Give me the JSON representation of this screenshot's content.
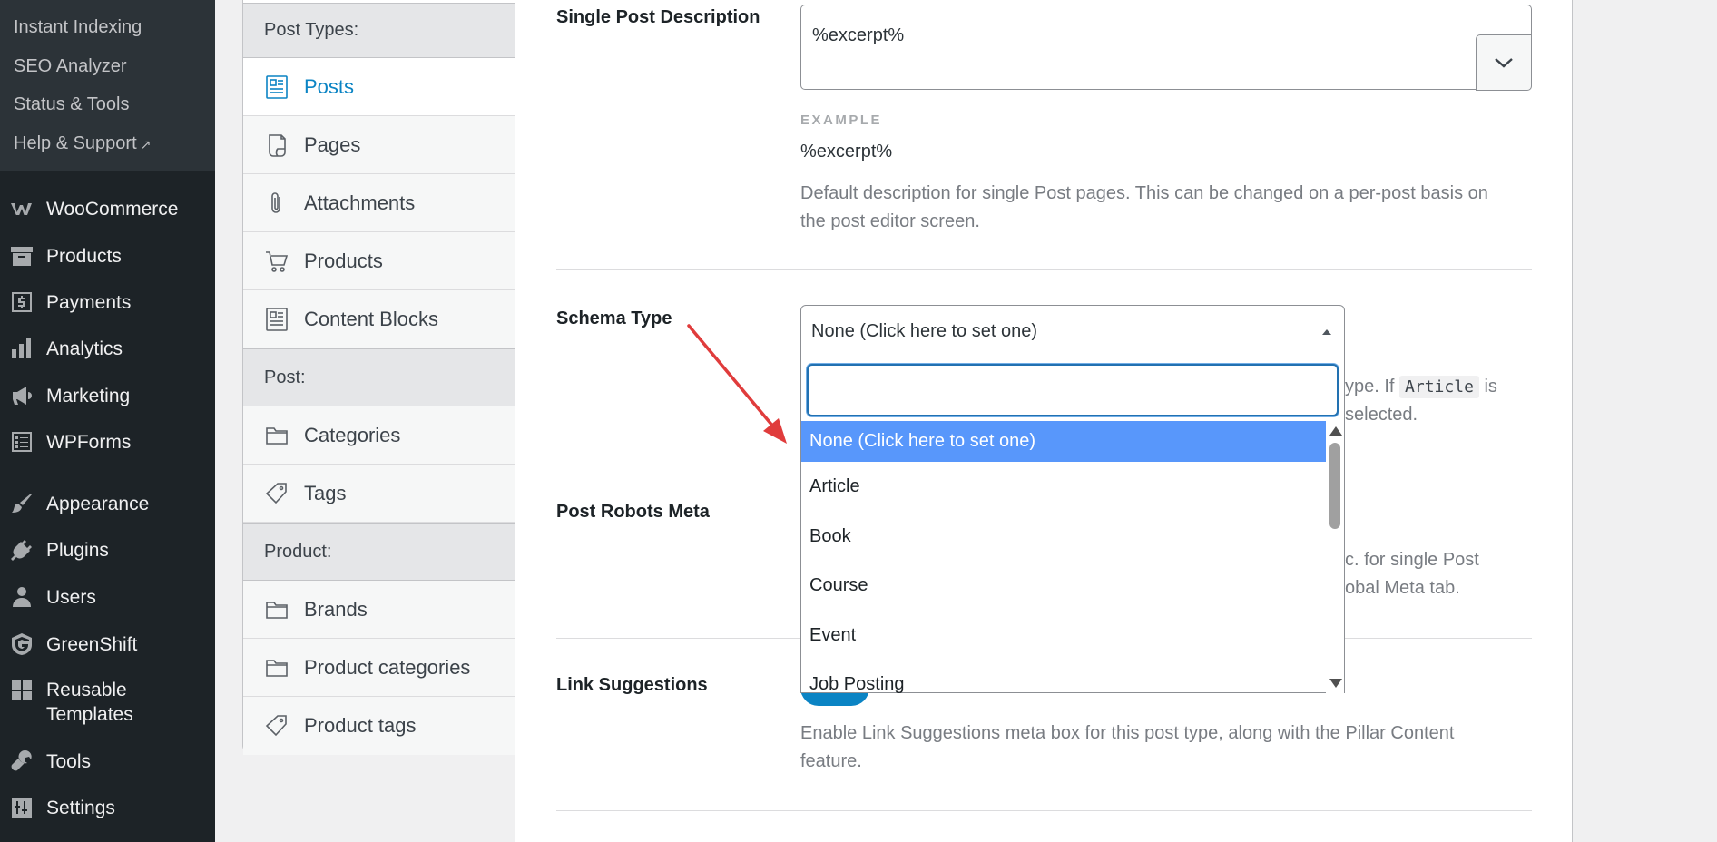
{
  "admin_menu": {
    "submenu": [
      {
        "label": "Instant Indexing"
      },
      {
        "label": "SEO Analyzer"
      },
      {
        "label": "Status & Tools"
      },
      {
        "label": "Help & Support",
        "external_icon": "↗"
      }
    ],
    "items": [
      {
        "label": "WooCommerce",
        "icon": "woocommerce-icon"
      },
      {
        "label": "Products",
        "icon": "archive-box-icon"
      },
      {
        "label": "Payments",
        "icon": "dollar-icon"
      },
      {
        "label": "Analytics",
        "icon": "bar-chart-icon"
      },
      {
        "label": "Marketing",
        "icon": "megaphone-icon"
      },
      {
        "label": "WPForms",
        "icon": "form-icon"
      },
      {
        "label": "Appearance",
        "icon": "paintbrush-icon"
      },
      {
        "label": "Plugins",
        "icon": "plug-icon"
      },
      {
        "label": "Users",
        "icon": "user-icon"
      },
      {
        "label": "GreenShift",
        "icon": "greenshift-icon"
      },
      {
        "label_line1": "Reusable",
        "label_line2": "Templates",
        "icon": "grid-icon"
      },
      {
        "label": "Tools",
        "icon": "wrench-icon"
      },
      {
        "label": "Settings",
        "icon": "sliders-icon"
      }
    ]
  },
  "tabs": {
    "groups": [
      {
        "header": "Post Types:"
      },
      {
        "header": "Post:"
      },
      {
        "header": "Product:"
      }
    ],
    "post_types": [
      {
        "label": "Posts",
        "icon": "document-icon",
        "active": true
      },
      {
        "label": "Pages",
        "icon": "page-icon"
      },
      {
        "label": "Attachments",
        "icon": "paperclip-icon"
      },
      {
        "label": "Products",
        "icon": "cart-icon"
      },
      {
        "label": "Content Blocks",
        "icon": "document-icon"
      }
    ],
    "post": [
      {
        "label": "Categories",
        "icon": "folder-icon"
      },
      {
        "label": "Tags",
        "icon": "tag-icon"
      }
    ],
    "product": [
      {
        "label": "Brands",
        "icon": "folder-icon"
      },
      {
        "label": "Product categories",
        "icon": "folder-icon"
      },
      {
        "label": "Product tags",
        "icon": "tag-icon"
      }
    ]
  },
  "settings": {
    "single_post_description": {
      "label": "Single Post Description",
      "value": "%excerpt%",
      "example_label": "EXAMPLE",
      "example_value": "%excerpt%",
      "description_line1": "Default description for single Post pages. This can be changed on a per-post basis on",
      "description_line2": "the post editor screen."
    },
    "schema_type": {
      "label": "Schema Type",
      "selected": "None (Click here to set one)",
      "search_placeholder": "",
      "desc_fragment1": "ype. If",
      "desc_code": "Article",
      "desc_fragment2": "is",
      "desc_fragment3": "selected.",
      "options": [
        {
          "label": "None (Click here to set one)",
          "highlighted": true
        },
        {
          "label": "Article"
        },
        {
          "label": "Book"
        },
        {
          "label": "Course"
        },
        {
          "label": "Event"
        },
        {
          "label": "Job Posting"
        }
      ]
    },
    "post_robots_meta": {
      "label": "Post Robots Meta",
      "desc_fragment1": "c. for single Post",
      "desc_fragment2": "obal Meta tab."
    },
    "link_suggestions": {
      "label": "Link Suggestions",
      "description_line1": "Enable Link Suggestions meta box for this post type, along with the Pillar Content",
      "description_line2": "feature."
    }
  },
  "colors": {
    "sidebar_bg": "#1d2327",
    "accent": "#0b84c4",
    "highlight": "#5897fb",
    "annotation_arrow": "#e03c3c"
  }
}
